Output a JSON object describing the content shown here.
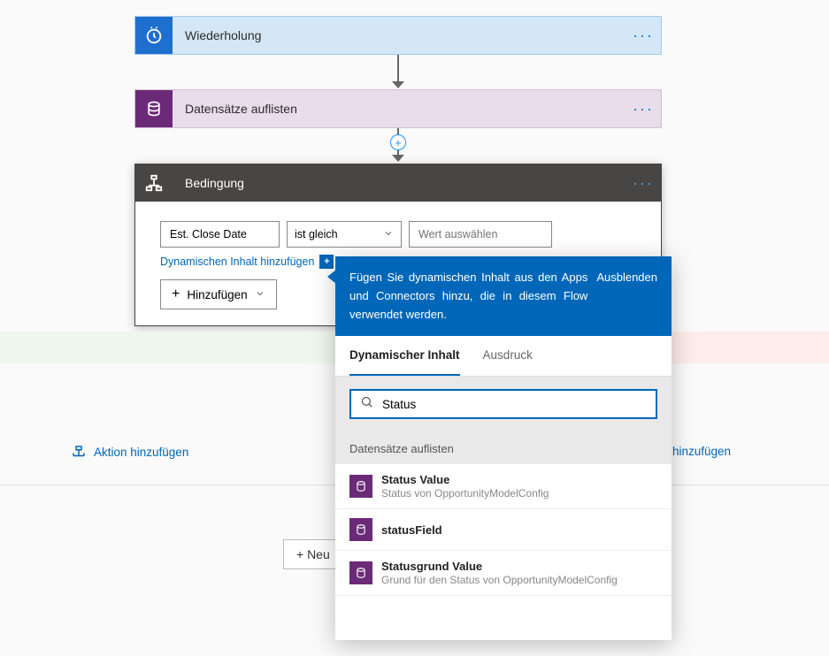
{
  "steps": {
    "recurrence": {
      "title": "Wiederholung"
    },
    "listrecords": {
      "title": "Datensätze auflisten"
    },
    "condition": {
      "title": "Bedingung"
    }
  },
  "condition": {
    "leftValue": "Est. Close Date",
    "operator": "ist gleich",
    "rightPlaceholder": "Wert auswählen",
    "dynamicLink": "Dynamischen Inhalt hinzufügen",
    "addButton": "Hinzufügen"
  },
  "dynamicPanel": {
    "headerText": "Fügen Sie dynamischen Inhalt aus den Apps und Connectors hinzu, die in diesem Flow verwendet werden.",
    "hideLabel": "Ausblenden",
    "tabs": {
      "dynamic": "Dynamischer Inhalt",
      "expression": "Ausdruck"
    },
    "searchValue": "Status",
    "sectionTitle": "Datensätze auflisten",
    "items": [
      {
        "title": "Status Value",
        "subtitle": "Status von OpportunityModelConfig"
      },
      {
        "title": "statusField",
        "subtitle": ""
      },
      {
        "title": "Statusgrund Value",
        "subtitle": "Grund für den Status von OpportunityModelConfig"
      }
    ]
  },
  "addAction": "Aktion hinzufügen",
  "addActionRight": "hinzufügen",
  "newStep": "+ Neu"
}
